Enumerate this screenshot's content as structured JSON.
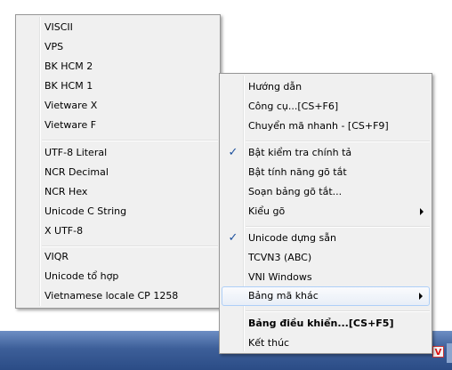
{
  "tray": {
    "icon_letter": "V"
  },
  "left_menu": {
    "items": [
      {
        "label": "VISCII"
      },
      {
        "label": "VPS"
      },
      {
        "label": "BK HCM 2"
      },
      {
        "label": "BK HCM 1"
      },
      {
        "label": "Vietware X"
      },
      {
        "label": "Vietware F"
      },
      {
        "label": "UTF-8 Literal"
      },
      {
        "label": "NCR Decimal"
      },
      {
        "label": "NCR Hex"
      },
      {
        "label": "Unicode C String"
      },
      {
        "label": "X UTF-8"
      },
      {
        "label": "VIQR"
      },
      {
        "label": "Unicode tổ hợp"
      },
      {
        "label": "Vietnamese locale CP 1258"
      }
    ]
  },
  "right_menu": {
    "items": [
      {
        "label": "Hướng dẫn"
      },
      {
        "label": "Công cụ...[CS+F6]"
      },
      {
        "label": "Chuyển mã nhanh - [CS+F9]"
      },
      {
        "label": "Bật kiểm tra chính tả",
        "checked": true
      },
      {
        "label": "Bật tính năng gõ tắt"
      },
      {
        "label": "Soạn bảng gõ tắt..."
      },
      {
        "label": "Kiểu gõ",
        "submenu": true
      },
      {
        "label": "Unicode dựng sẵn",
        "checked": true
      },
      {
        "label": "TCVN3 (ABC)"
      },
      {
        "label": "VNI Windows"
      },
      {
        "label": "Bảng mã khác",
        "submenu": true,
        "highlighted": true
      },
      {
        "label": "Bảng điều khiển...[CS+F5]",
        "bold": true
      },
      {
        "label": "Kết thúc"
      }
    ],
    "check_glyph": "✓"
  },
  "colors": {
    "menu_bg": "#f0f0f0",
    "menu_border": "#979797",
    "highlight_border": "#aecff7",
    "check_color": "#1b4f9c",
    "taskbar": "#3d5f99"
  }
}
